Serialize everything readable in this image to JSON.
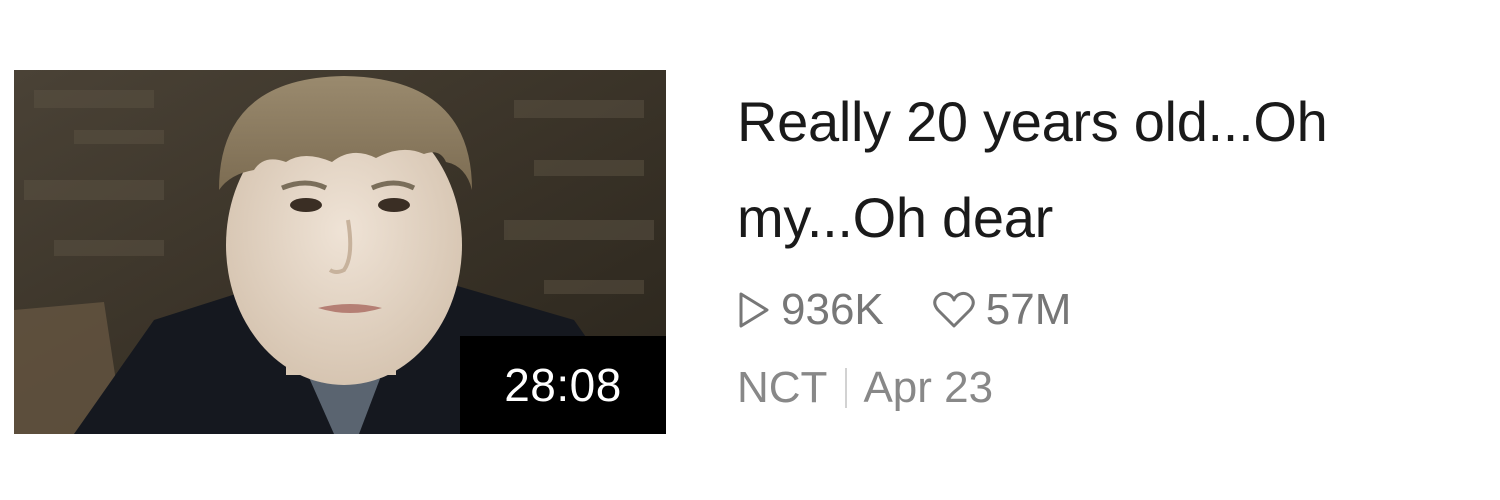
{
  "video": {
    "title": "Really 20 years old...Oh my...Oh dear",
    "duration": "28:08",
    "views": "936K",
    "likes": "57M",
    "channel": "NCT",
    "date": "Apr 23"
  },
  "icons": {
    "views": "play-icon",
    "likes": "heart-icon"
  },
  "colors": {
    "title": "#1a1a1a",
    "stats": "#777777",
    "badge_bg": "#000000",
    "badge_text": "#ffffff"
  }
}
